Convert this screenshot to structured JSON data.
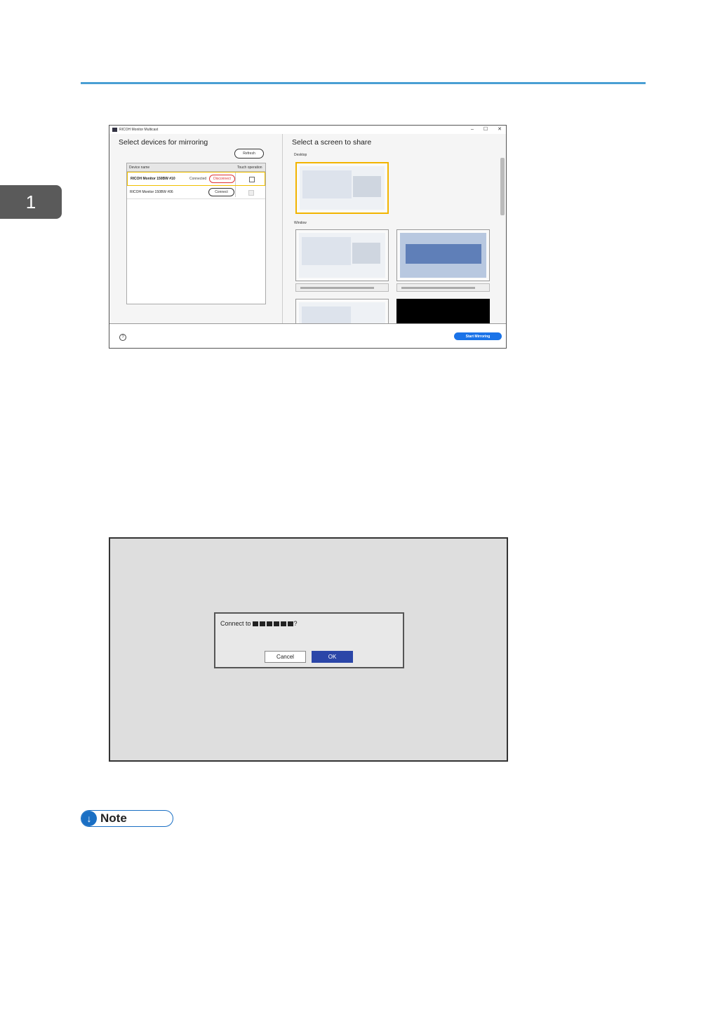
{
  "chapter": {
    "number": "1"
  },
  "mirroring_app": {
    "window_title": "RICOH Monitor Multicast",
    "window_controls": [
      "–",
      "☐",
      "✕"
    ],
    "left": {
      "title": "Select devices for mirroring",
      "refresh_label": "Refresh",
      "columns": [
        "Device name",
        "Touch operation"
      ],
      "devices": [
        {
          "name": "RICOH Monitor 150BW #10",
          "status": "Connected",
          "action": "Disconnect",
          "selected": true
        },
        {
          "name": "RICOH Monitor 150BW #06",
          "status": "",
          "action": "Connect",
          "selected": false
        }
      ]
    },
    "right": {
      "title": "Select a screen to share",
      "desktop_label": "Desktop",
      "window_label": "Window"
    },
    "footer": {
      "help_icon": "?",
      "start_label": "Start Mirroring"
    }
  },
  "connect_dialog": {
    "message_prefix": "Connect to ",
    "message_suffix": "?",
    "cancel_label": "Cancel",
    "ok_label": "OK"
  },
  "note": {
    "label": "Note",
    "icon": "↓"
  }
}
